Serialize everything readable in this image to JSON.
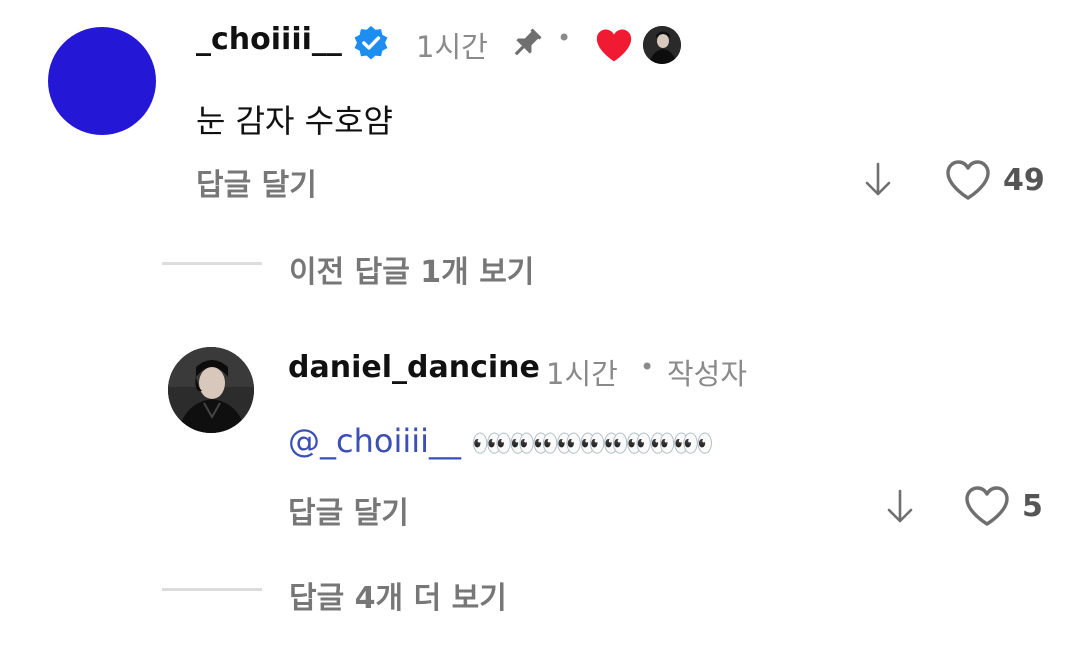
{
  "comment": {
    "username": "_choiiii__",
    "time": "1시간",
    "separator": "•",
    "text": "눈 감자 수호얌",
    "reply_label": "답글 달기",
    "like_count": "49"
  },
  "view_previous": "이전 답글 1개 보기",
  "reply": {
    "username": "daniel_dancine",
    "time": "1시간",
    "separator": "•",
    "author_badge": "작성자",
    "mention": "@_choiiii__",
    "emojis": "👀👀👀👀👀👀👀👀👀👀",
    "reply_label": "답글 달기",
    "like_count": "5"
  },
  "view_more": "답글 4개 더 보기",
  "colors": {
    "avatar": "#2417d6",
    "verified": "#1d8df0",
    "heart_red": "#f01a32",
    "mention": "#3c4fb5"
  },
  "icons": [
    "verified-badge-icon",
    "pin-icon",
    "heart-filled-icon",
    "heart-outline-icon",
    "arrow-down-icon"
  ]
}
